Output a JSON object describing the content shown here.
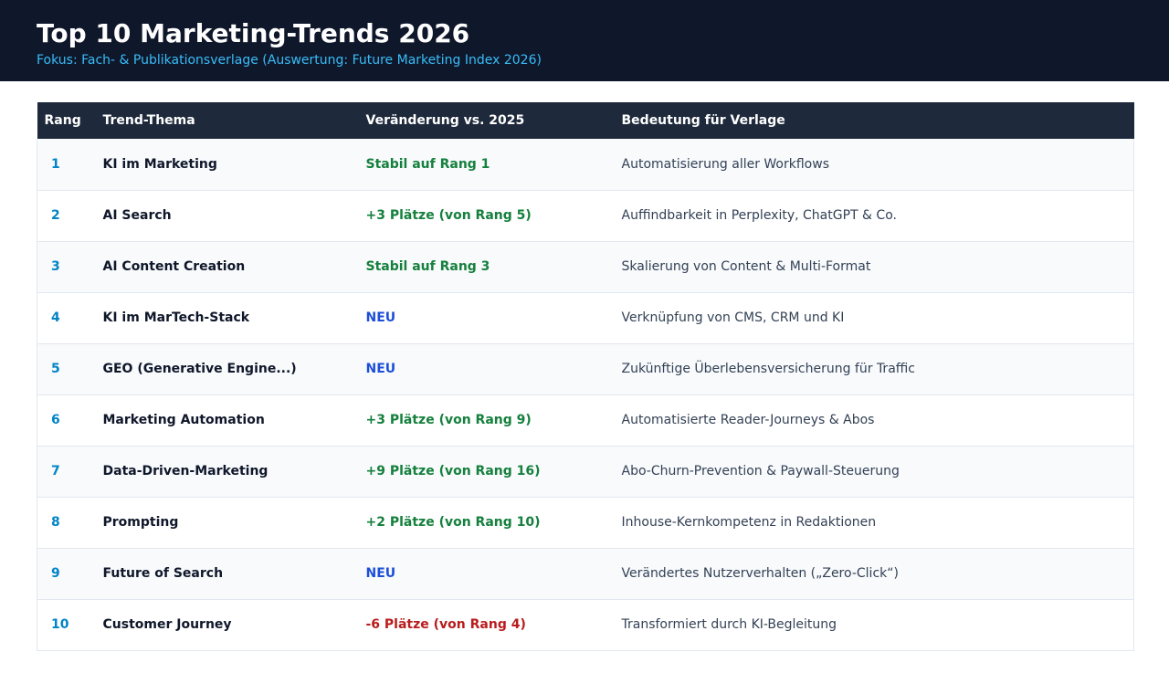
{
  "header": {
    "title": "Top 10 Marketing-Trends 2026",
    "subtitle": "Fokus: Fach- & Publikationsverlage (Auswertung: Future Marketing Index 2026)"
  },
  "table": {
    "columns": [
      "Rang",
      "Trend-Thema",
      "Veränderung vs. 2025",
      "Bedeutung für Verlage"
    ],
    "rows": [
      {
        "rank": "1",
        "topic": "KI im Marketing",
        "change": "Stabil auf Rang 1",
        "change_type": "up",
        "meaning": "Automatisierung aller Workflows"
      },
      {
        "rank": "2",
        "topic": "AI Search",
        "change": "+3 Plätze (von Rang 5)",
        "change_type": "up",
        "meaning": "Auffindbarkeit in Perplexity, ChatGPT & Co."
      },
      {
        "rank": "3",
        "topic": "AI Content Creation",
        "change": "Stabil auf Rang 3",
        "change_type": "up",
        "meaning": "Skalierung von Content & Multi-Format"
      },
      {
        "rank": "4",
        "topic": "KI im MarTech-Stack",
        "change": "NEU",
        "change_type": "new",
        "meaning": "Verknüpfung von CMS, CRM und KI"
      },
      {
        "rank": "5",
        "topic": "GEO (Generative Engine...)",
        "change": "NEU",
        "change_type": "new",
        "meaning": "Zukünftige Überlebensversicherung für Traffic"
      },
      {
        "rank": "6",
        "topic": "Marketing Automation",
        "change": "+3 Plätze (von Rang 9)",
        "change_type": "up",
        "meaning": "Automatisierte Reader-Journeys & Abos"
      },
      {
        "rank": "7",
        "topic": "Data-Driven-Marketing",
        "change": "+9 Plätze (von Rang 16)",
        "change_type": "up",
        "meaning": "Abo-Churn-Prevention & Paywall-Steuerung"
      },
      {
        "rank": "8",
        "topic": "Prompting",
        "change": "+2 Plätze (von Rang 10)",
        "change_type": "up",
        "meaning": "Inhouse-Kernkompetenz in Redaktionen"
      },
      {
        "rank": "9",
        "topic": "Future of Search",
        "change": "NEU",
        "change_type": "new",
        "meaning": "Verändertes Nutzerverhalten („Zero-Click“)"
      },
      {
        "rank": "10",
        "topic": "Customer Journey",
        "change": "-6 Plätze (von Rang 4)",
        "change_type": "down",
        "meaning": "Transformiert durch KI-Begleitung"
      }
    ]
  },
  "colors": {
    "header_bg": "#0f172a",
    "table_header_bg": "#1e293b",
    "accent_rank": "#0284c7",
    "positive": "#15803d",
    "new": "#1d4ed8",
    "negative": "#b91c1c"
  }
}
